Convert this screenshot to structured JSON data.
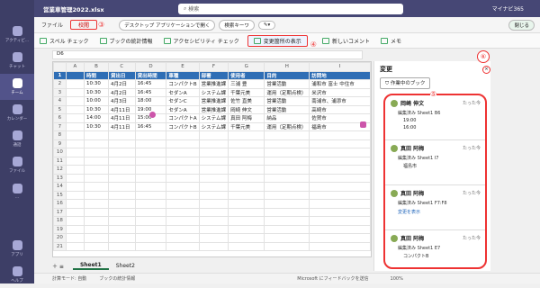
{
  "titlebar": {
    "filename": "営業車管理2022.xlsx",
    "search_placeholder": "検索",
    "user": "マイナビ365"
  },
  "rail": [
    {
      "label": "アクティビ...",
      "icon": "bell-icon"
    },
    {
      "label": "チャット",
      "icon": "chat-icon"
    },
    {
      "label": "チーム",
      "icon": "team-icon",
      "active": true
    },
    {
      "label": "カレンダー",
      "icon": "calendar-icon"
    },
    {
      "label": "通話",
      "icon": "phone-icon"
    },
    {
      "label": "ファイル",
      "icon": "file-icon"
    },
    {
      "label": "...",
      "icon": "more-icon"
    }
  ],
  "rail_bottom": [
    {
      "label": "アプリ"
    },
    {
      "label": "ヘルプ"
    }
  ],
  "ribbon1": {
    "file": "ファイル",
    "review": "校閲",
    "desktop_open": "デスクトップ アプリケーションで開く",
    "search_keys": "検索キーワ",
    "close": "閉じる"
  },
  "ribbon2": {
    "spell": "スペル チェック",
    "stats": "ブックの統計情報",
    "access": "アクセシビリティ チェック",
    "show_changes": "変更箇所の表示",
    "new_comment": "新しいコメント",
    "memo": "メモ"
  },
  "formula": {
    "cell": "D6"
  },
  "columns": [
    "",
    "A",
    "B",
    "C",
    "D",
    "E",
    "F",
    "G",
    "H",
    "I"
  ],
  "header": [
    "時間",
    "貸出日",
    "貸出時間",
    "車種",
    "部署",
    "使用者",
    "目的",
    "訪問地"
  ],
  "rows": [
    [
      "2",
      "10:30",
      "4月2日",
      "16:45",
      "コンパクトB",
      "営業推進課",
      "三浦 豊",
      "営業活動",
      "浦和市 富士 中住市"
    ],
    [
      "3",
      "10:30",
      "4月2日",
      "16:45",
      "セダンA",
      "システム課",
      "千葉元美",
      "運用（定期点検）",
      "米沢市"
    ],
    [
      "4",
      "10:00",
      "4月3日",
      "18:00",
      "セダンC",
      "営業推進課",
      "佐竹 直美",
      "営業活動",
      "南浦市、浦添市"
    ],
    [
      "5",
      "10:30",
      "4月11日",
      "19:00",
      "セダンA",
      "営業推進課",
      "岡崎 伸文",
      "営業活動",
      "高崎市"
    ],
    [
      "6",
      "14:00",
      "4月11日",
      "15:00",
      "コンパクトA",
      "システム課",
      "真田 阿梅",
      "納品",
      "佐賀市"
    ],
    [
      "7",
      "10:30",
      "4月11日",
      "16:45",
      "コンパクトB",
      "システム課",
      "千葉元美",
      "運用（定期点検）",
      "福島市"
    ],
    [
      "8",
      "",
      "",
      "",
      "",
      "",
      "",
      "",
      ""
    ],
    [
      "9",
      "",
      "",
      "",
      "",
      "",
      "",
      "",
      ""
    ],
    [
      "10",
      "",
      "",
      "",
      "",
      "",
      "",
      "",
      ""
    ],
    [
      "11",
      "",
      "",
      "",
      "",
      "",
      "",
      "",
      ""
    ],
    [
      "12",
      "",
      "",
      "",
      "",
      "",
      "",
      "",
      ""
    ],
    [
      "13",
      "",
      "",
      "",
      "",
      "",
      "",
      "",
      ""
    ],
    [
      "14",
      "",
      "",
      "",
      "",
      "",
      "",
      "",
      ""
    ],
    [
      "15",
      "",
      "",
      "",
      "",
      "",
      "",
      "",
      ""
    ],
    [
      "16",
      "",
      "",
      "",
      "",
      "",
      "",
      "",
      ""
    ],
    [
      "17",
      "",
      "",
      "",
      "",
      "",
      "",
      "",
      ""
    ],
    [
      "18",
      "",
      "",
      "",
      "",
      "",
      "",
      "",
      ""
    ],
    [
      "19",
      "",
      "",
      "",
      "",
      "",
      "",
      "",
      ""
    ],
    [
      "20",
      "",
      "",
      "",
      "",
      "",
      "",
      "",
      ""
    ],
    [
      "21",
      "",
      "",
      "",
      "",
      "",
      "",
      "",
      ""
    ]
  ],
  "sheets": [
    "Sheet1",
    "Sheet2"
  ],
  "status": {
    "calc": "計算モード: 自動",
    "stats": "ブックの統計情報",
    "feedback": "Microsoft にフィードバックを送信",
    "zoom": "100%"
  },
  "pane": {
    "title": "変更",
    "filter": "作業中のブック",
    "cards": [
      {
        "name": "岡崎 伸文",
        "time": "たった今",
        "line": "編集済み Sheet1 B6",
        "v1": "19:00",
        "v2": "16:00"
      },
      {
        "name": "真田 阿梅",
        "time": "たった今",
        "line": "編集済み Sheet1 I7",
        "v1": "福島市",
        "v2": ""
      },
      {
        "name": "真田 阿梅",
        "time": "たった今",
        "line": "編集済み Sheet1 F7:F8",
        "v1": "変更を表示",
        "v2": ""
      },
      {
        "name": "真田 阿梅",
        "time": "たった今",
        "line": "編集済み Sheet1 E7",
        "v1": "コンパクトB",
        "v2": ""
      }
    ]
  },
  "annotations": [
    "③",
    "④",
    "⑤",
    "⑥"
  ]
}
